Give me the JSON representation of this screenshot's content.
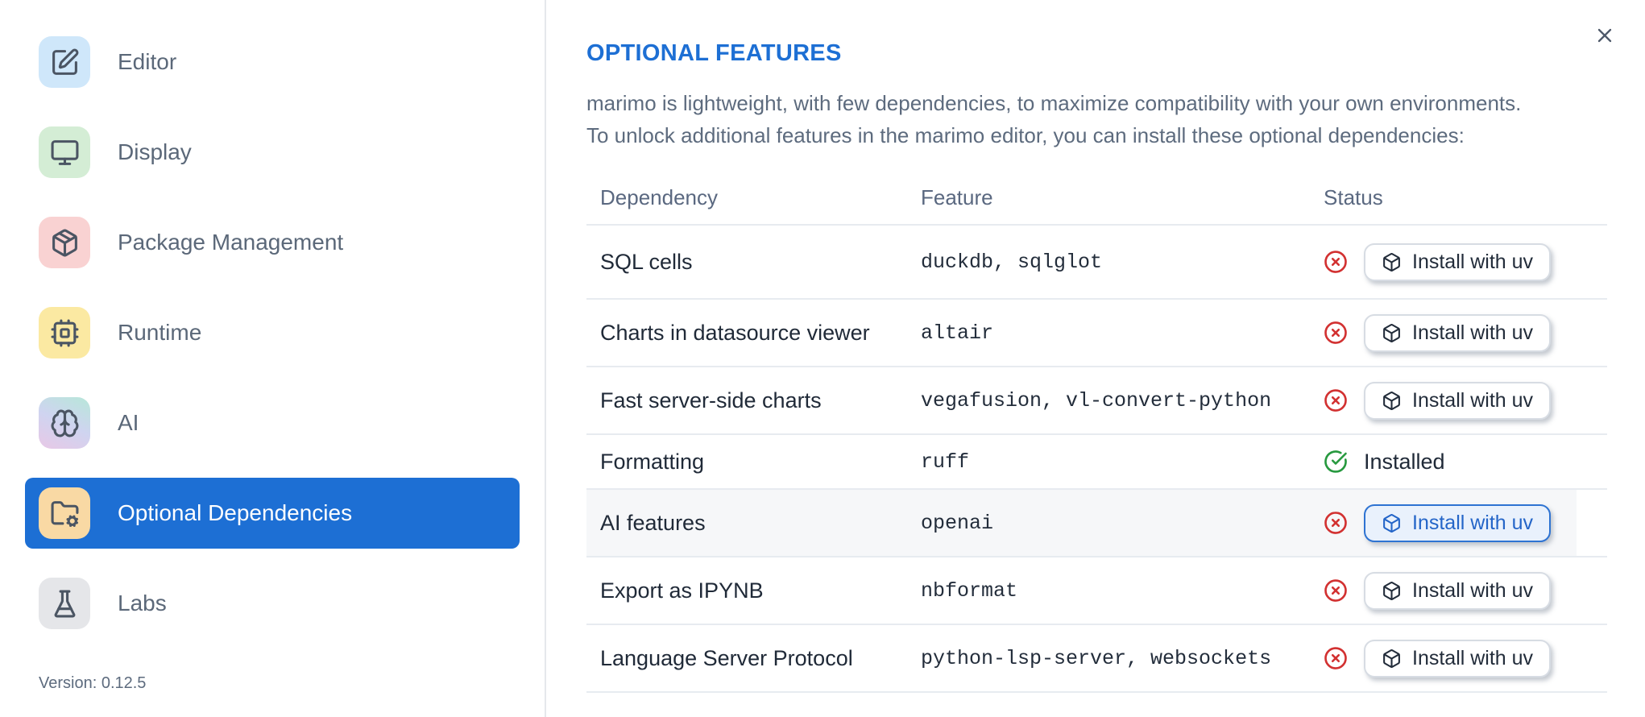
{
  "colors": {
    "accent": "#1d6fd4",
    "red": "#d23131",
    "green": "#27993f",
    "row_highlight": "#f6f7f9",
    "border": "#e7ebf0"
  },
  "sidebar": {
    "items": [
      {
        "label": "Editor",
        "icon": "square-pen-icon",
        "tile_color": "#cfe7fa",
        "selected": false
      },
      {
        "label": "Display",
        "icon": "monitor-icon",
        "tile_color": "#d4edd5",
        "selected": false
      },
      {
        "label": "Package Management",
        "icon": "package-icon",
        "tile_color": "#f9d2d2",
        "selected": false
      },
      {
        "label": "Runtime",
        "icon": "cpu-icon",
        "tile_color": "#fbe9a2",
        "selected": false
      },
      {
        "label": "AI",
        "icon": "brain-icon",
        "tile_gradient": [
          "#b7e7d9",
          "#cfd4f0",
          "#e8c8e6"
        ],
        "selected": false
      },
      {
        "label": "Optional Dependencies",
        "icon": "folder-cog-icon",
        "tile_color": "#f9d9a4",
        "selected": true
      },
      {
        "label": "Labs",
        "icon": "flask-icon",
        "tile_color": "#e5e6e9",
        "selected": false
      }
    ],
    "version_label": "Version: 0.12.5"
  },
  "dialog": {
    "title": "OPTIONAL FEATURES",
    "description_line1": "marimo is lightweight, with few dependencies, to maximize compatibility with your own environments.",
    "description_line2": "To unlock additional features in the marimo editor, you can install these optional dependencies:",
    "table": {
      "columns": [
        "Dependency",
        "Feature",
        "Status"
      ],
      "rows": [
        {
          "dependency": "SQL cells",
          "feature": "duckdb, sqlglot",
          "status": "missing",
          "action": "Install with uv",
          "highlighted": false,
          "button_focused": false
        },
        {
          "dependency": "Charts in datasource viewer",
          "feature": "altair",
          "status": "missing",
          "action": "Install with uv",
          "highlighted": false,
          "button_focused": false
        },
        {
          "dependency": "Fast server-side charts",
          "feature": "vegafusion, vl-convert-python",
          "status": "missing",
          "action": "Install with uv",
          "highlighted": false,
          "button_focused": false
        },
        {
          "dependency": "Formatting",
          "feature": "ruff",
          "status": "installed",
          "status_label": "Installed",
          "highlighted": false,
          "button_focused": false
        },
        {
          "dependency": "AI features",
          "feature": "openai",
          "status": "missing",
          "action": "Install with uv",
          "highlighted": true,
          "button_focused": true
        },
        {
          "dependency": "Export as IPYNB",
          "feature": "nbformat",
          "status": "missing",
          "action": "Install with uv",
          "highlighted": false,
          "button_focused": false
        },
        {
          "dependency": "Language Server Protocol",
          "feature": "python-lsp-server, websockets",
          "status": "missing",
          "action": "Install with uv",
          "highlighted": false,
          "button_focused": false
        }
      ]
    }
  }
}
